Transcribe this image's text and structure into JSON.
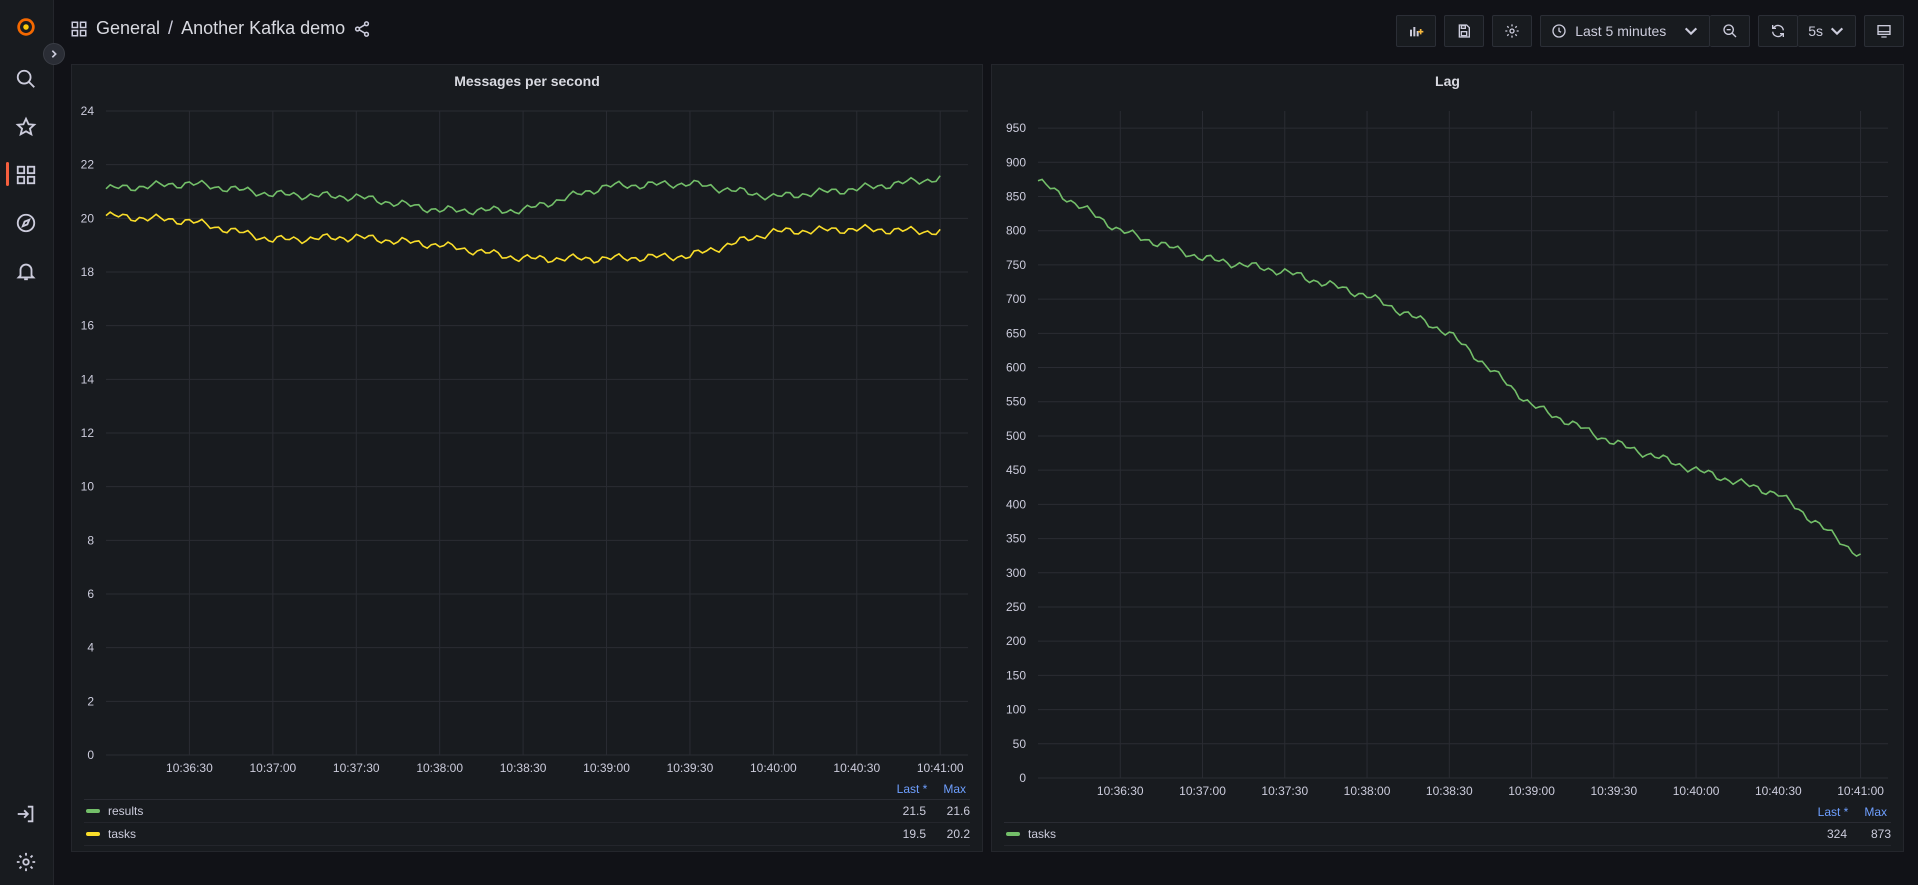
{
  "breadcrumb": {
    "folder": "General",
    "separator": "/",
    "dashboard": "Another Kafka demo"
  },
  "toolbar": {
    "time_range": "Last 5 minutes",
    "refresh_interval": "5s"
  },
  "colors": {
    "green": "#73bf69",
    "yellow": "#fade2a",
    "accent": "#f55f3e"
  },
  "icons": [
    "grafana-logo-icon",
    "search-icon",
    "star-icon",
    "dashboards-icon",
    "explore-icon",
    "alert-bell-icon",
    "sign-in-icon",
    "gear-icon",
    "share-icon",
    "add-panel-icon",
    "save-icon",
    "settings-icon",
    "clock-icon",
    "zoom-out-icon",
    "refresh-icon",
    "tv-mode-icon"
  ],
  "legend_headers": {
    "last": "Last *",
    "max": "Max"
  },
  "panels": [
    {
      "title": "Messages per second",
      "legend": [
        {
          "name": "results",
          "last": "21.5",
          "max": "21.6"
        },
        {
          "name": "tasks",
          "last": "19.5",
          "max": "20.2"
        }
      ]
    },
    {
      "title": "Lag",
      "legend": [
        {
          "name": "tasks",
          "last": "324",
          "max": "873"
        }
      ]
    }
  ],
  "chart_data": [
    {
      "type": "line",
      "title": "Messages per second",
      "x": [
        "10:36:00",
        "10:36:30",
        "10:37:00",
        "10:37:30",
        "10:38:00",
        "10:38:30",
        "10:39:00",
        "10:39:30",
        "10:40:00",
        "10:40:30",
        "10:41:00"
      ],
      "x_ticks": [
        "10:36:30",
        "10:37:00",
        "10:37:30",
        "10:38:00",
        "10:38:30",
        "10:39:00",
        "10:39:30",
        "10:40:00",
        "10:40:30",
        "10:41:00"
      ],
      "ylim": [
        0,
        24
      ],
      "y_ticks": [
        0,
        2,
        4,
        6,
        8,
        10,
        12,
        14,
        16,
        18,
        20,
        22,
        24
      ],
      "grid": true,
      "legend_placement": "bottom",
      "series": [
        {
          "name": "results",
          "color": "#73bf69",
          "values": [
            21.1,
            21.3,
            20.9,
            20.8,
            20.3,
            20.3,
            21.2,
            21.3,
            20.8,
            21.1,
            21.5
          ]
        },
        {
          "name": "tasks",
          "color": "#fade2a",
          "values": [
            20.1,
            19.9,
            19.2,
            19.3,
            19.0,
            18.5,
            18.5,
            18.6,
            19.5,
            19.6,
            19.5
          ]
        }
      ]
    },
    {
      "type": "line",
      "title": "Lag",
      "x": [
        "10:36:00",
        "10:36:30",
        "10:37:00",
        "10:37:30",
        "10:38:00",
        "10:38:30",
        "10:39:00",
        "10:39:30",
        "10:40:00",
        "10:40:30",
        "10:41:00"
      ],
      "x_ticks": [
        "10:36:30",
        "10:37:00",
        "10:37:30",
        "10:38:00",
        "10:38:30",
        "10:39:00",
        "10:39:30",
        "10:40:00",
        "10:40:30",
        "10:41:00"
      ],
      "ylim": [
        0,
        975
      ],
      "y_ticks": [
        0,
        50,
        100,
        150,
        200,
        250,
        300,
        350,
        400,
        450,
        500,
        550,
        600,
        650,
        700,
        750,
        800,
        850,
        900,
        950
      ],
      "grid": true,
      "legend_placement": "bottom",
      "series": [
        {
          "name": "tasks",
          "color": "#73bf69",
          "values": [
            873,
            800,
            760,
            740,
            705,
            650,
            545,
            490,
            450,
            415,
            324
          ]
        }
      ]
    }
  ]
}
